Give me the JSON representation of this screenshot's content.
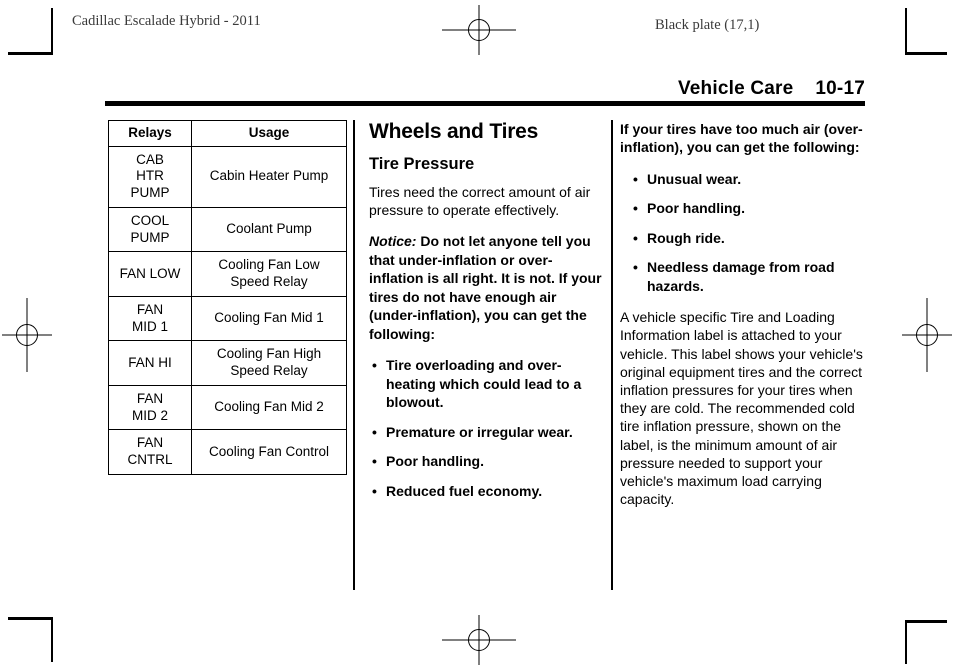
{
  "running_head": {
    "left": "Cadillac Escalade Hybrid - 2011",
    "right": "Black plate (17,1)"
  },
  "page_header": {
    "title": "Vehicle Care",
    "page_number": "10-17"
  },
  "relay_table": {
    "headers": [
      "Relays",
      "Usage"
    ],
    "rows": [
      {
        "relay": "CAB\nHTR\nPUMP",
        "usage": "Cabin Heater Pump"
      },
      {
        "relay": "COOL\nPUMP",
        "usage": "Coolant Pump"
      },
      {
        "relay": "FAN LOW",
        "usage": "Cooling Fan Low\nSpeed Relay"
      },
      {
        "relay": "FAN\nMID 1",
        "usage": "Cooling Fan Mid 1"
      },
      {
        "relay": "FAN HI",
        "usage": "Cooling Fan High\nSpeed Relay"
      },
      {
        "relay": "FAN\nMID 2",
        "usage": "Cooling Fan Mid 2"
      },
      {
        "relay": "FAN\nCNTRL",
        "usage": "Cooling Fan Control"
      }
    ]
  },
  "middle_column": {
    "section_title": "Wheels and Tires",
    "subsection_title": "Tire Pressure",
    "intro_paragraph": "Tires need the correct amount of air pressure to operate effectively.",
    "notice_label": "Notice:",
    "notice_text": "Do not let anyone tell you that under-inflation or over-inflation is all right. It is not. If your tires do not have enough air (under-inflation), you can get the following:",
    "under_inflation_bullets": [
      "Tire overloading and over-heating which could lead to a blowout.",
      "Premature or irregular wear.",
      "Poor handling.",
      "Reduced fuel economy."
    ]
  },
  "right_column": {
    "over_inflation_heading": "If your tires have too much air (over-inflation), you can get the following:",
    "over_inflation_bullets": [
      "Unusual wear.",
      "Poor handling.",
      "Rough ride.",
      "Needless damage from road hazards."
    ],
    "label_paragraph": "A vehicle specific Tire and Loading Information label is attached to your vehicle. This label shows your vehicle's original equipment tires and the correct inflation pressures for your tires when they are cold. The recommended cold tire inflation pressure, shown on the label, is the minimum amount of air pressure needed to support your vehicle's maximum load carrying capacity."
  },
  "bullet_glyph": "•"
}
